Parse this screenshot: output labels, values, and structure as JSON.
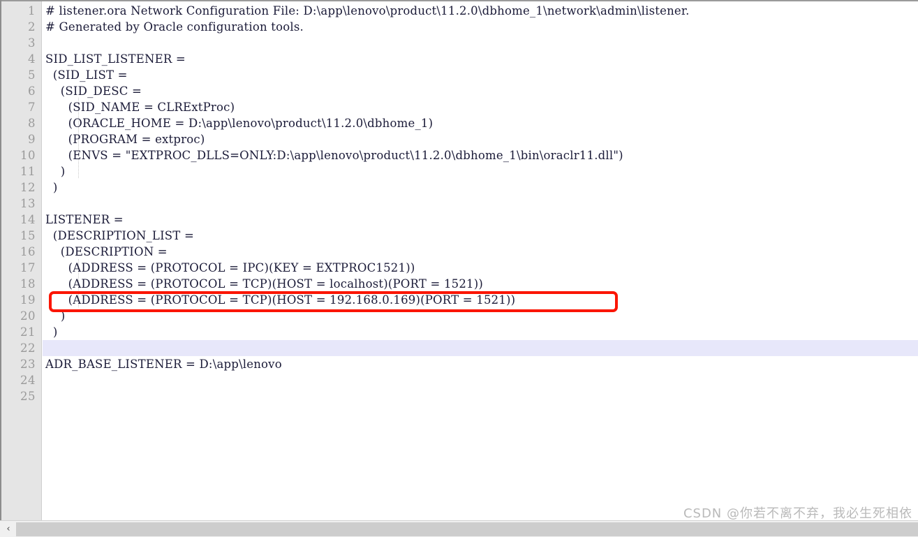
{
  "app": {
    "kind": "text-editor-code-view",
    "filename": "listener.ora",
    "accent_red": "#fb1502",
    "gutter_bg": "#e5e5e5",
    "gutter_fg": "#9a9a9a",
    "code_fg": "#1b1b38",
    "current_line_bg": "#e7e7fa",
    "page_bg": "#ffffff"
  },
  "gutter": {
    "line_numbers": [
      "1",
      "2",
      "3",
      "4",
      "5",
      "6",
      "7",
      "8",
      "9",
      "10",
      "11",
      "12",
      "13",
      "14",
      "15",
      "16",
      "17",
      "18",
      "19",
      "20",
      "21",
      "22",
      "23",
      "24",
      "25"
    ],
    "total_lines": 25,
    "current_line": 22
  },
  "code": {
    "lines": [
      "# listener.ora Network Configuration File: D:\\app\\lenovo\\product\\11.2.0\\dbhome_1\\network\\admin\\listener.",
      "# Generated by Oracle configuration tools.",
      "",
      "SID_LIST_LISTENER =",
      "  (SID_LIST =",
      "    (SID_DESC =",
      "      (SID_NAME = CLRExtProc)",
      "      (ORACLE_HOME = D:\\app\\lenovo\\product\\11.2.0\\dbhome_1)",
      "      (PROGRAM = extproc)",
      "      (ENVS = \"EXTPROC_DLLS=ONLY:D:\\app\\lenovo\\product\\11.2.0\\dbhome_1\\bin\\oraclr11.dll\")",
      "    )",
      "  )",
      "",
      "LISTENER =",
      "  (DESCRIPTION_LIST =",
      "    (DESCRIPTION =",
      "      (ADDRESS = (PROTOCOL = IPC)(KEY = EXTPROC1521))",
      "      (ADDRESS = (PROTOCOL = TCP)(HOST = localhost)(PORT = 1521))",
      "      (ADDRESS = (PROTOCOL = TCP)(HOST = 192.168.0.169)(PORT = 1521))",
      "    )",
      "  )",
      "",
      "ADR_BASE_LISTENER = D:\\app\\lenovo",
      "",
      ""
    ]
  },
  "annotation": {
    "type": "red-rectangle-highlight",
    "target_line": 19,
    "target_text": "(ADDRESS = (PROTOCOL = TCP)(HOST = 192.168.0.169)(PORT = 1521))",
    "color": "#fb1502"
  },
  "scrollbar": {
    "orientation": "horizontal",
    "left_arrow": "‹",
    "right_arrow": "›"
  },
  "watermark": {
    "text": "CSDN @你若不离不弃，我必生死相依"
  }
}
